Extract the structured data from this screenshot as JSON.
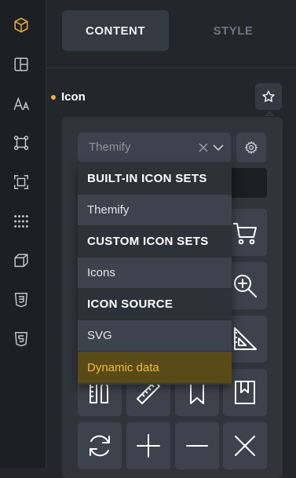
{
  "colors": {
    "accent": "#e8b13a",
    "sidebar_bg": "#1c1f23",
    "panel_bg": "#30353c",
    "highlight_bg": "#5a4a17"
  },
  "sidebar": {
    "items": [
      {
        "icon": "cube-icon",
        "active": true
      },
      {
        "icon": "layout-icon"
      },
      {
        "icon": "typography-icon"
      },
      {
        "icon": "component-icon"
      },
      {
        "icon": "frame-icon"
      },
      {
        "icon": "dots-grid-icon"
      },
      {
        "icon": "box-3d-icon"
      },
      {
        "icon": "css3-icon"
      },
      {
        "icon": "html5-icon"
      }
    ]
  },
  "tabs": {
    "content_label": "CONTENT",
    "style_label": "STYLE",
    "active": "content"
  },
  "field": {
    "label": "Icon",
    "star_icon": "star-icon"
  },
  "icon_set_select": {
    "value": "Themify",
    "clear_icon": "close-icon",
    "chevron_icon": "chevron-down-icon",
    "settings_icon": "gear-icon"
  },
  "dropdown": {
    "groups": [
      {
        "header": "BUILT-IN ICON SETS",
        "options": [
          "Themify"
        ]
      },
      {
        "header": "CUSTOM ICON SETS",
        "options": [
          "Icons"
        ]
      },
      {
        "header": "ICON SOURCE",
        "options": [
          "SVG",
          "Dynamic data"
        ]
      }
    ],
    "highlighted": "Dynamic data"
  },
  "icon_grid": {
    "tiles": [
      "shopping-cart-icon",
      "zoom-in-icon",
      "set-square-icon",
      "pencil-ruler-icon",
      "ruler-icon",
      "bookmark-icon",
      "bookmark-alt-icon",
      "refresh-icon",
      "plus-icon",
      "minus-icon",
      "close-icon"
    ]
  }
}
